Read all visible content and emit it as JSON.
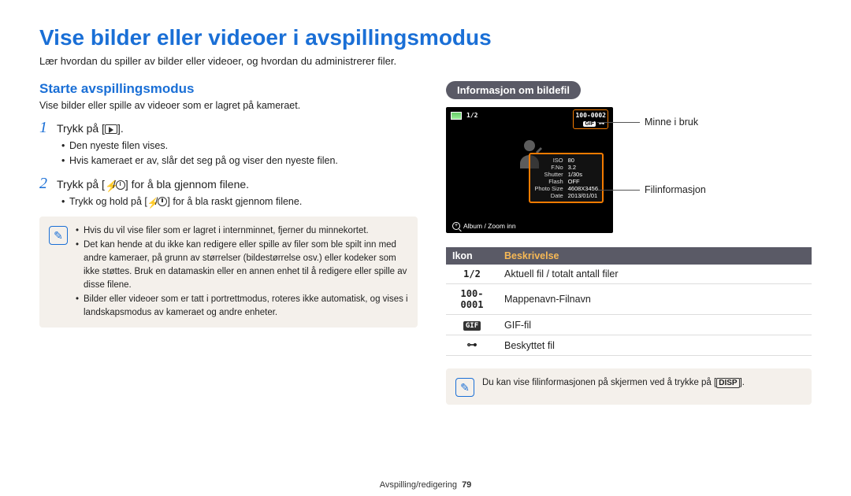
{
  "page": {
    "title": "Vise bilder eller videoer i avspillingsmodus",
    "lead": "Lær hvordan du spiller av bilder eller videoer, og hvordan du administrerer filer."
  },
  "left": {
    "section_title": "Starte avspillingsmodus",
    "section_desc": "Vise bilder eller spille av videoer som er lagret på kameraet.",
    "steps": [
      {
        "num": "1",
        "text_pre": "Trykk på [",
        "text_post": "].",
        "bullets": [
          "Den nyeste filen vises.",
          "Hvis kameraet er av, slår det seg på og viser den nyeste filen."
        ]
      },
      {
        "num": "2",
        "text_pre": "Trykk på [",
        "text_mid": "/",
        "text_post": "] for å bla gjennom filene.",
        "bullets_special": {
          "pre": "Trykk og hold på [",
          "mid": "/",
          "post": "] for å bla raskt gjennom filene."
        }
      }
    ],
    "note": [
      "Hvis du vil vise filer som er lagret i internminnet, fjerner du minnekortet.",
      "Det kan hende at du ikke kan redigere eller spille av filer som ble spilt inn med andre kameraer, på grunn av størrelser (bildestørrelse osv.) eller kodeker som ikke støttes. Bruk en datamaskin eller en annen enhet til å redigere eller spille av disse filene.",
      "Bilder eller videoer som er tatt i portrettmodus, roteres ikke automatisk, og vises i landskapsmodus av kameraet og andre enheter."
    ]
  },
  "right": {
    "pill": "Informasjon om bildefil",
    "screen": {
      "counter": "1/2",
      "fileno": "100-0002",
      "gif": "GIF",
      "info_rows": [
        {
          "label": "ISO",
          "value": "80"
        },
        {
          "label": "F.No",
          "value": "3.2"
        },
        {
          "label": "Shutter",
          "value": "1/30s"
        },
        {
          "label": "Flash",
          "value": "OFF"
        },
        {
          "label": "Photo Size",
          "value": "4608X3456"
        },
        {
          "label": "Date",
          "value": "2013/01/01"
        }
      ],
      "bottom": "Album / Zoom inn"
    },
    "callouts": {
      "memory": "Minne i bruk",
      "fileinfo": "Filinformasjon"
    },
    "table": {
      "head_icon": "Ikon",
      "head_desc": "Beskrivelse",
      "rows": [
        {
          "icon_text": "1/2",
          "desc": "Aktuell fil / totalt antall filer"
        },
        {
          "icon_text": "100-0001",
          "desc": "Mappenavn-Filnavn"
        },
        {
          "icon_text": "GIF",
          "desc": "GIF-fil",
          "gif": true
        },
        {
          "icon_text": "lock",
          "desc": "Beskyttet fil",
          "lock": true
        }
      ]
    },
    "note2_pre": "Du kan vise filinformasjonen på skjermen ved å trykke på [",
    "note2_btn": "DISP",
    "note2_post": "]."
  },
  "footer": {
    "section": "Avspilling/redigering",
    "page": "79"
  }
}
